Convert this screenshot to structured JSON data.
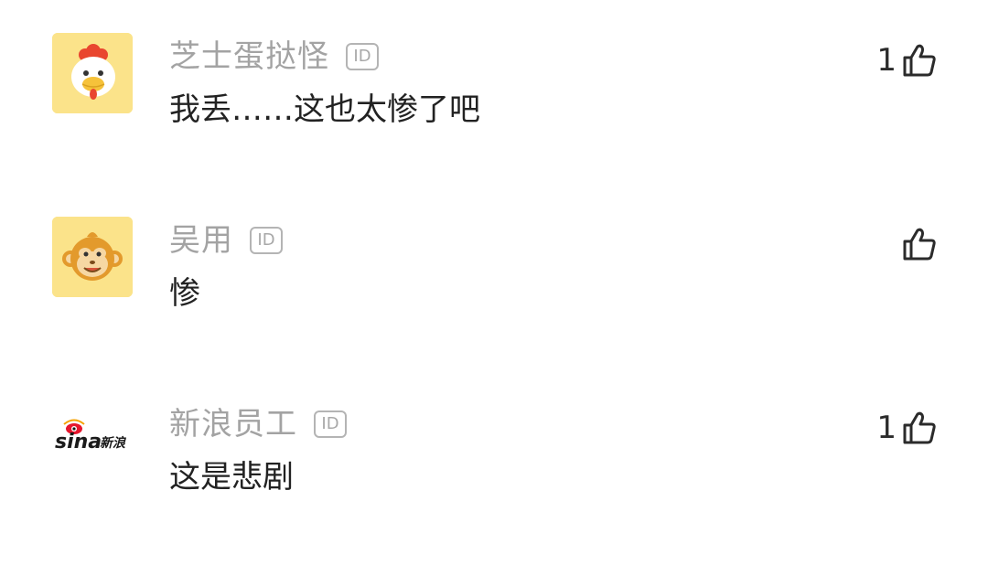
{
  "comments": [
    {
      "username": "芝士蛋挞怪",
      "id_badge": "ID",
      "text": "我丢……这也太惨了吧",
      "likes": "1",
      "avatar": "chicken-avatar"
    },
    {
      "username": "吴用",
      "id_badge": "ID",
      "text": "惨",
      "likes": "",
      "avatar": "monkey-avatar"
    },
    {
      "username": "新浪员工",
      "id_badge": "ID",
      "text": "这是悲剧",
      "likes": "1",
      "avatar": "sina-logo"
    }
  ],
  "sina_logo_text": "sina新浪",
  "colors": {
    "avatar_bg": "#fbe38a",
    "username": "#a3a3a3",
    "text": "#222222",
    "sina_red": "#e6162d"
  },
  "icons": {
    "like": "thumbs-up-icon"
  }
}
